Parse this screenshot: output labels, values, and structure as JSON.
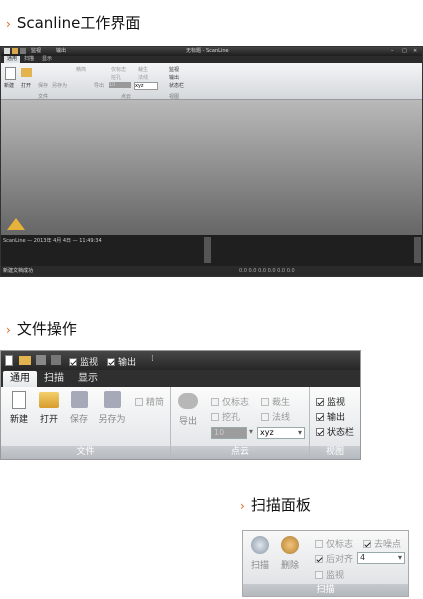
{
  "sections": {
    "s1_title": "Scanline工作界面",
    "s2_title": "文件操作",
    "s3_title": "扫描面板"
  },
  "app": {
    "window_title": "无标题 - ScanLine",
    "qat": {
      "monitor": "监视",
      "output": "输出"
    },
    "tabs": [
      "通用",
      "扫描",
      "显示"
    ],
    "file_group": {
      "caption": "文件",
      "new": "新建",
      "open": "打开",
      "save": "保存",
      "save_as": "另存为",
      "simplify": "精简"
    },
    "cloud_group": {
      "caption": "点云",
      "export": "导出",
      "flag_only": "仅标志",
      "hole": "挖孔",
      "crop": "裁生",
      "normal": "法线",
      "value": "10",
      "format": "xyz"
    },
    "view_group": {
      "caption": "视图",
      "monitor": "监视",
      "output": "输出",
      "statusbar": "状态栏"
    },
    "console_line": "ScanLine — 2013年 4月 4日 — 11:49:34",
    "status_text": "新建文档成功",
    "status_coords": "0.0  0.0  0.0  0.0    0.0    0.0"
  },
  "scan_panel": {
    "scan": "扫描",
    "delete": "删除",
    "flag_only": "仅标志",
    "denoise": "去噪点",
    "back_align": "后对齐",
    "align_value": "4",
    "monitor": "监视",
    "caption": "扫描"
  },
  "colors": {
    "accent_arrow": "#d9661a"
  }
}
